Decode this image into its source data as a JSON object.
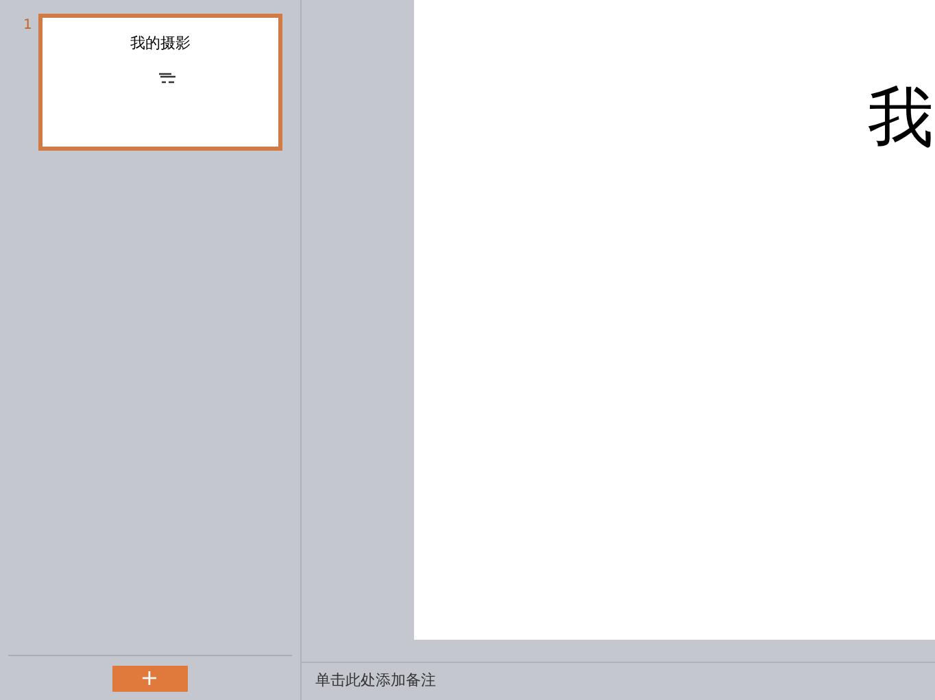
{
  "thumbnails": [
    {
      "number": "1",
      "title": "我的摄影",
      "selected": true
    }
  ],
  "add_slide_button": {
    "label": "+"
  },
  "slide": {
    "title": "我"
  },
  "notes": {
    "placeholder": "单击此处添加备注"
  }
}
